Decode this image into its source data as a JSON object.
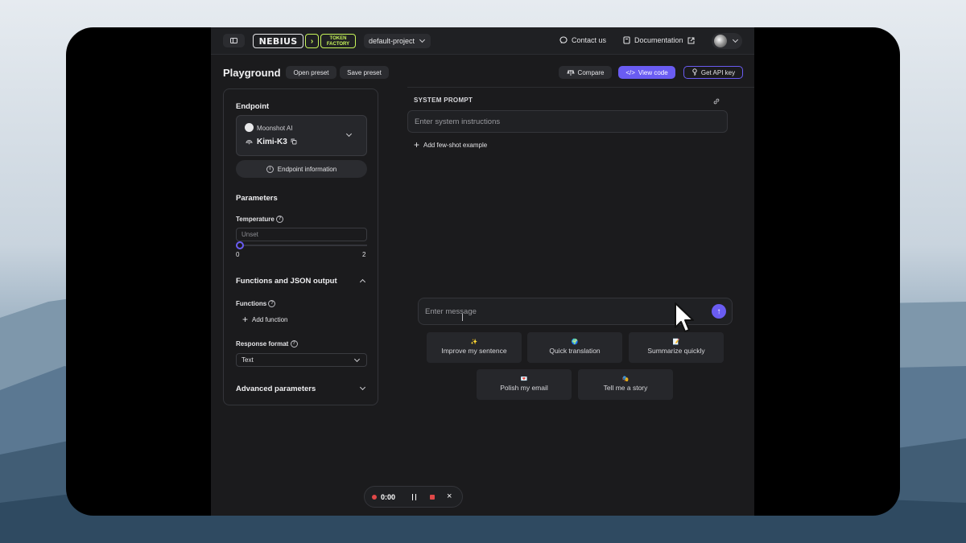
{
  "topbar": {
    "logo_left": "NEBIUS",
    "logo_right_line1": "TOKEN",
    "logo_right_line2": "FACTORY",
    "project": "default-project",
    "contact": "Contact us",
    "documentation": "Documentation"
  },
  "header": {
    "title": "Playground",
    "open_preset": "Open preset",
    "save_preset": "Save preset",
    "compare": "Compare",
    "view_code": "View code",
    "get_api_key": "Get API key"
  },
  "sidebar": {
    "endpoint_heading": "Endpoint",
    "provider": "Moonshot AI",
    "model": "Kimi-K3",
    "endpoint_info": "Endpoint information",
    "parameters_heading": "Parameters",
    "temperature_label": "Temperature",
    "temperature_placeholder": "Unset",
    "temperature_min": "0",
    "temperature_max": "2",
    "temperature_value_fraction": 0,
    "functions_heading": "Functions and JSON output",
    "functions_label": "Functions",
    "add_function": "Add function",
    "response_format_label": "Response format",
    "response_format_value": "Text",
    "advanced_heading": "Advanced parameters"
  },
  "main": {
    "system_prompt_label": "SYSTEM PROMPT",
    "system_prompt_placeholder": "Enter system instructions",
    "add_few_shot": "Add few-shot example",
    "message_placeholder": "Enter message",
    "suggestions": [
      {
        "emoji": "✨",
        "label": "Improve my sentence"
      },
      {
        "emoji": "🌍",
        "label": "Quick translation"
      },
      {
        "emoji": "📝",
        "label": "Summarize quickly"
      },
      {
        "emoji": "💌",
        "label": "Polish my email"
      },
      {
        "emoji": "🎭",
        "label": "Tell me a story"
      }
    ]
  },
  "recorder": {
    "time": "0:00"
  },
  "colors": {
    "accent": "#6a5cf2",
    "brand_green": "#c7f45a",
    "record_red": "#e04848"
  }
}
